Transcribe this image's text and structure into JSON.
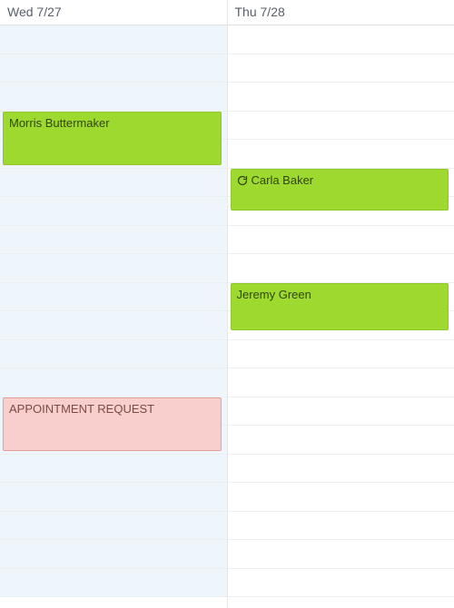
{
  "days": [
    {
      "label": "Wed 7/27",
      "outside_hours": true
    },
    {
      "label": "Thu 7/28",
      "outside_hours": false
    }
  ],
  "slots_per_day": 20,
  "outside_hours_pattern_day0": [
    true,
    true,
    true,
    true,
    true,
    true,
    true,
    true,
    true,
    true,
    true,
    true,
    true,
    true,
    true,
    true,
    true,
    true,
    true,
    true
  ],
  "outside_hours_pattern_day1": [
    false,
    false,
    false,
    false,
    false,
    false,
    false,
    false,
    false,
    false,
    false,
    false,
    false,
    false,
    false,
    false,
    false,
    false,
    false,
    false
  ],
  "events": {
    "morris": {
      "title": "Morris Buttermaker",
      "color": "green",
      "recurring": false
    },
    "request": {
      "title": "APPOINTMENT REQUEST",
      "color": "red",
      "recurring": false
    },
    "carla": {
      "title": "Carla Baker",
      "color": "green",
      "recurring": true
    },
    "jeremy": {
      "title": "Jeremy Green",
      "color": "green",
      "recurring": false
    }
  },
  "layout": {
    "slot_height": 31.5,
    "morris": {
      "day": 0,
      "top_slot": 3,
      "span_slots": 2
    },
    "request": {
      "day": 0,
      "top_slot": 13,
      "span_slots": 2
    },
    "carla": {
      "day": 1,
      "top_slot": 5,
      "span_slots": 1.6
    },
    "jeremy": {
      "day": 1,
      "top_slot": 9,
      "span_slots": 1.8
    }
  }
}
